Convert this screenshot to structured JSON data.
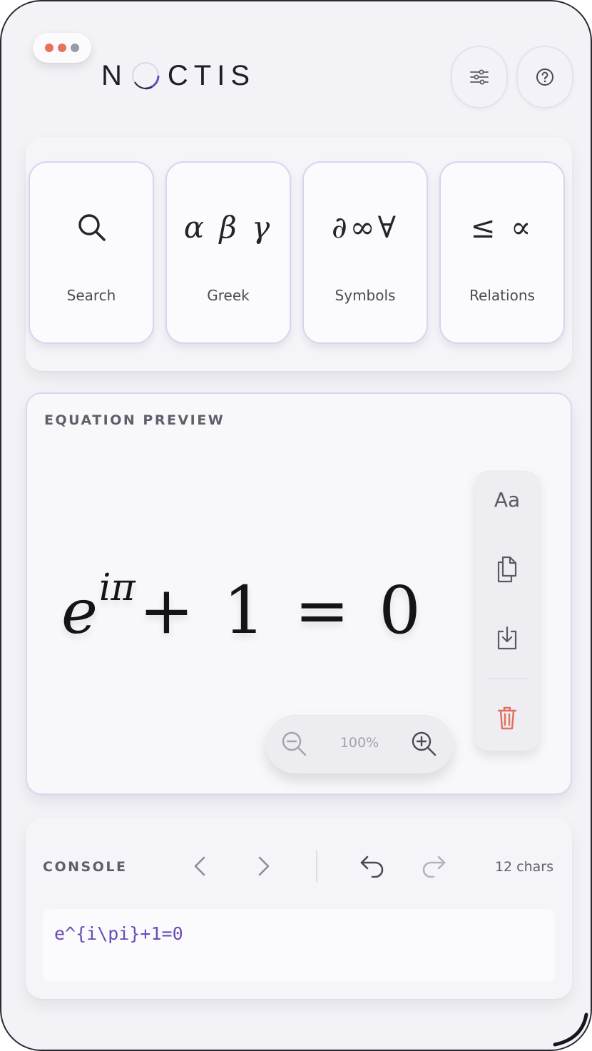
{
  "app": {
    "brand": "NOCTIS",
    "window_dot_colors": [
      "#e9705c",
      "#e9705c",
      "#9b9ba3"
    ]
  },
  "header": {
    "settings_icon": "sliders-icon",
    "help_icon": "help-circle-icon"
  },
  "palette": {
    "tiles": [
      {
        "label": "Search",
        "glyph": "",
        "icon": "search-icon"
      },
      {
        "label": "Greek",
        "glyph": "α β γ"
      },
      {
        "label": "Symbols",
        "glyph": "∂∞∀"
      },
      {
        "label": "Relations",
        "glyph": "≤ ∝"
      }
    ]
  },
  "preview": {
    "title": "EQUATION PREVIEW",
    "equation": {
      "base": "e",
      "superscript": "iπ",
      "rest": "+ 1 = 0"
    },
    "tools": {
      "font_label": "Aa",
      "copy_icon": "copy-icon",
      "download_icon": "download-icon",
      "delete_icon": "trash-icon"
    },
    "zoom": {
      "value": "100%",
      "out_icon": "zoom-out-icon",
      "in_icon": "zoom-in-icon"
    }
  },
  "console": {
    "title": "CONSOLE",
    "char_count": "12 chars",
    "input": "e^{i\\pi}+1=0"
  },
  "colors": {
    "accent": "#6a4bb8",
    "tile_border": "#d9d2f2",
    "danger": "#e2705f"
  }
}
